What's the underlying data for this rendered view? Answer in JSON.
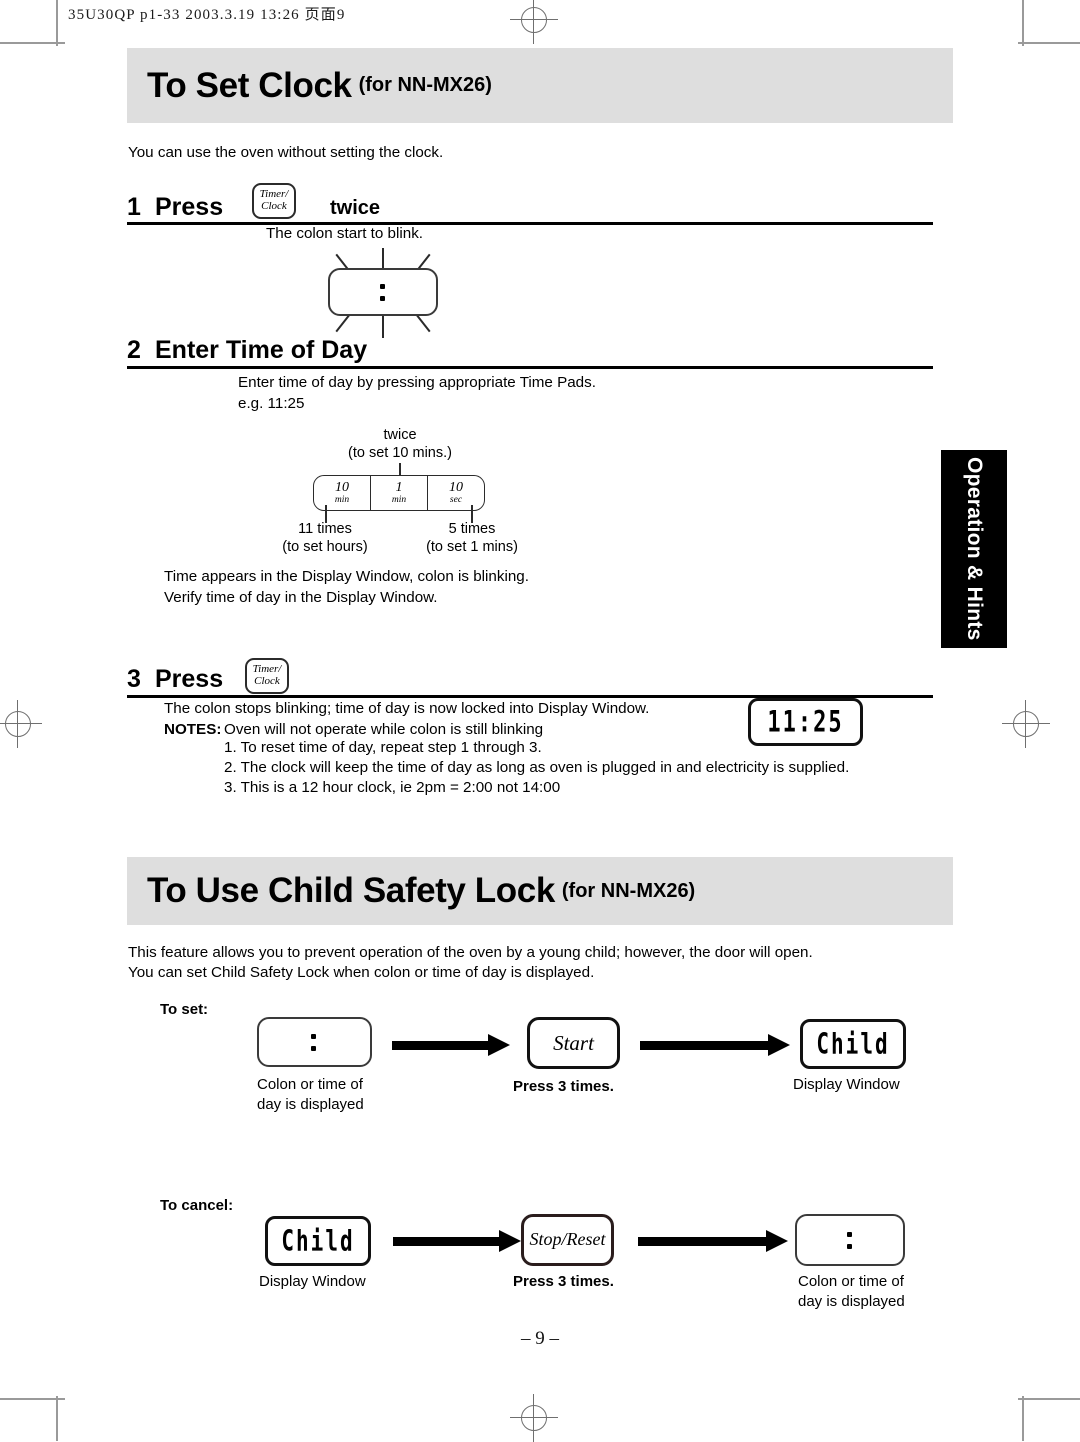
{
  "prepress": {
    "slug": "35U30QP p1-33   2003.3.19 13:26   页面9",
    "folio": "– 9 –"
  },
  "side_tab": {
    "label": "Operation & Hints"
  },
  "section_clock": {
    "title": "To Set Clock",
    "model": "(for NN-MX26)",
    "intro": "You can use the oven without setting the clock.",
    "step1": {
      "number": "1",
      "action": "Press",
      "key": {
        "line1": "Timer/",
        "line2": "Clock"
      },
      "suffix": "twice",
      "note": "The colon start to blink.",
      "display": "colon-blinking"
    },
    "step2": {
      "number": "2",
      "action": "Enter Time of Day",
      "line1": "Enter time of day by pressing appropriate Time Pads.",
      "line2": "e.g. 11:25",
      "pads": [
        {
          "value": "10",
          "unit": "min"
        },
        {
          "value": "1",
          "unit": "min"
        },
        {
          "value": "10",
          "unit": "sec"
        }
      ],
      "callout_top": {
        "l1": "twice",
        "l2": "(to set 10 mins.)"
      },
      "callout_left": {
        "l1": "11 times",
        "l2": "(to set hours)"
      },
      "callout_right": {
        "l1": "5 times",
        "l2": "(to set 1 mins)"
      },
      "after1": "Time appears in the Display Window, colon is blinking.",
      "after2": "Verify time of day in the Display Window."
    },
    "step3": {
      "number": "3",
      "action": "Press",
      "key": {
        "line1": "Timer/",
        "line2": "Clock"
      },
      "line1": "The colon stops blinking; time of day is now locked into Display Window.",
      "notes_label": "NOTES:",
      "notes_lead": "Oven will not operate while colon is still blinking",
      "notes": [
        "1. To reset time of day, repeat step 1 through 3.",
        "2. The clock will keep the time of day as long as oven is plugged in and electricity is supplied.",
        "3. This is a 12 hour clock, ie 2pm = 2:00 not 14:00"
      ],
      "display": "11:25"
    }
  },
  "section_lock": {
    "title": "To Use Child Safety Lock",
    "model": "(for NN-MX26)",
    "intro1": "This feature allows you to prevent operation of the oven by a young child; however, the door will open.",
    "intro2": "You can set Child Safety Lock when colon or time of day is displayed.",
    "to_set": {
      "label": "To set:",
      "start_display": "colon",
      "start_caption1": "Colon or time of",
      "start_caption2": "day is displayed",
      "button": "Start",
      "button_caption": "Press 3 times.",
      "end_display": "Child",
      "end_caption": "Display Window"
    },
    "to_cancel": {
      "label": "To cancel:",
      "start_display": "Child",
      "start_caption": "Display Window",
      "button": "Stop/Reset",
      "button_caption": "Press 3 times.",
      "end_display": "colon",
      "end_caption1": "Colon or time of",
      "end_caption2": "day is displayed"
    }
  }
}
